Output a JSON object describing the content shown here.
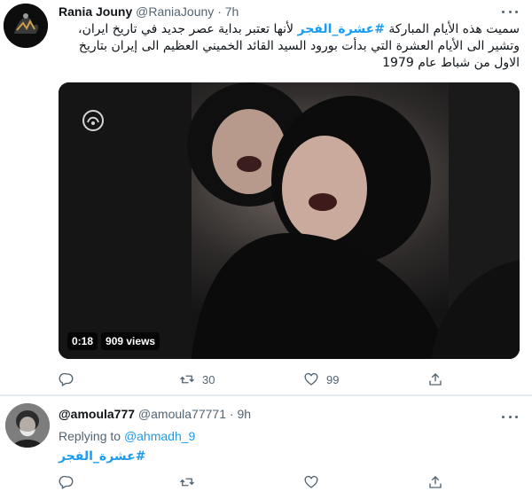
{
  "tweet1": {
    "display_name": "Rania Jouny",
    "handle": "@RaniaJouny",
    "separator": "·",
    "time": "7h",
    "text_before_tag": "سميت هذه الأيام المباركة ",
    "hashtag": "#عشرة_الفجر",
    "text_after_tag": " لأنها تعتبر بداية عصر جديد في تاريخ ايران، وتشير الى الأيام العشرة التي بدأت بورود السيد القائد الخميني العظيم الى إيران بتاريخ الاول من شباط عام 1979",
    "video": {
      "duration": "0:18",
      "views": "909 views"
    },
    "actions": {
      "reply_count": "",
      "retweet_count": "30",
      "like_count": "99"
    }
  },
  "tweet2": {
    "display_name": "@amoula777",
    "handle": "@amoula77771",
    "separator": "·",
    "time": "9h",
    "replying_to_label": "Replying to",
    "replying_to_handle": "@ahmadh_9",
    "hashtag": "#عشرة_الفجر",
    "actions": {
      "reply_count": "",
      "retweet_count": "",
      "like_count": ""
    }
  },
  "colors": {
    "accent": "#1d9bf0",
    "secondary_text": "#536471",
    "divider": "#e6ecf0"
  },
  "icons": [
    "more-icon",
    "reply-icon",
    "retweet-icon",
    "like-icon",
    "share-icon",
    "channel-logo-icon"
  ]
}
